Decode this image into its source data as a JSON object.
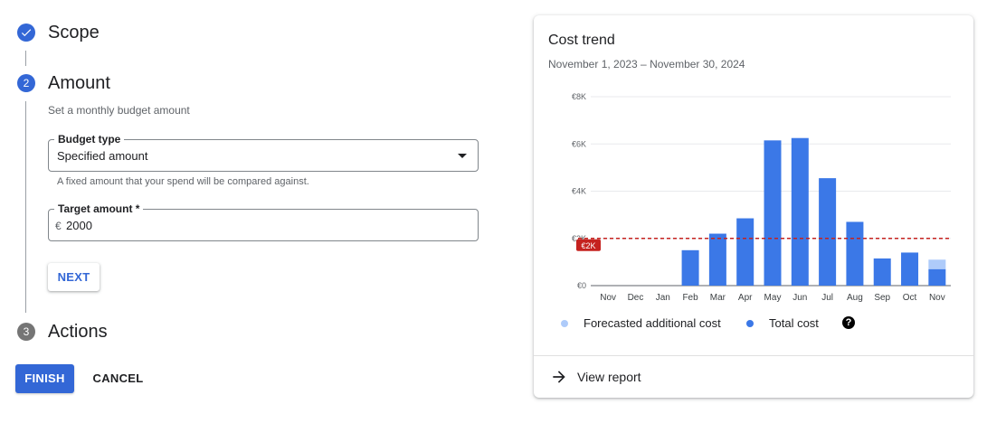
{
  "stepper": {
    "steps": [
      {
        "number": "✓",
        "title": "Scope",
        "state": "completed"
      },
      {
        "number": "2",
        "title": "Amount",
        "state": "active"
      },
      {
        "number": "3",
        "title": "Actions",
        "state": "pending"
      }
    ],
    "amount": {
      "description": "Set a monthly budget amount",
      "budget_type": {
        "label": "Budget type",
        "value": "Specified amount",
        "hint": "A fixed amount that your spend will be compared against."
      },
      "target_amount": {
        "label": "Target amount *",
        "currency": "€",
        "value": "2000"
      },
      "next_label": "NEXT"
    }
  },
  "footer": {
    "finish_label": "FINISH",
    "cancel_label": "CANCEL"
  },
  "card": {
    "title": "Cost trend",
    "date_range": "November 1, 2023 – November 30, 2024",
    "view_report_label": "View report"
  },
  "colors": {
    "primary": "#3367d6",
    "total_cost": "#3b78e7",
    "forecast": "#aecbfa",
    "budget_line": "#c5221f"
  },
  "chart_data": {
    "type": "bar",
    "categories": [
      "Nov",
      "Dec",
      "Jan",
      "Feb",
      "Mar",
      "Apr",
      "May",
      "Jun",
      "Jul",
      "Aug",
      "Sep",
      "Oct",
      "Nov"
    ],
    "series": [
      {
        "name": "Total cost",
        "values": [
          0,
          0,
          0,
          1500,
          2200,
          2850,
          6150,
          6250,
          4550,
          2700,
          1150,
          1400,
          700
        ]
      },
      {
        "name": "Forecasted additional cost",
        "values": [
          0,
          0,
          0,
          0,
          0,
          0,
          0,
          0,
          0,
          0,
          0,
          0,
          400
        ]
      }
    ],
    "yticks": [
      "€0",
      "€2K",
      "€4K",
      "€6K",
      "€8K"
    ],
    "ylim": [
      0,
      8000
    ],
    "budget_line": {
      "value": 2000,
      "label": "€2K"
    },
    "legend": [
      "Forecasted additional cost",
      "Total cost"
    ],
    "legend_position": "bottom",
    "grid": true
  }
}
